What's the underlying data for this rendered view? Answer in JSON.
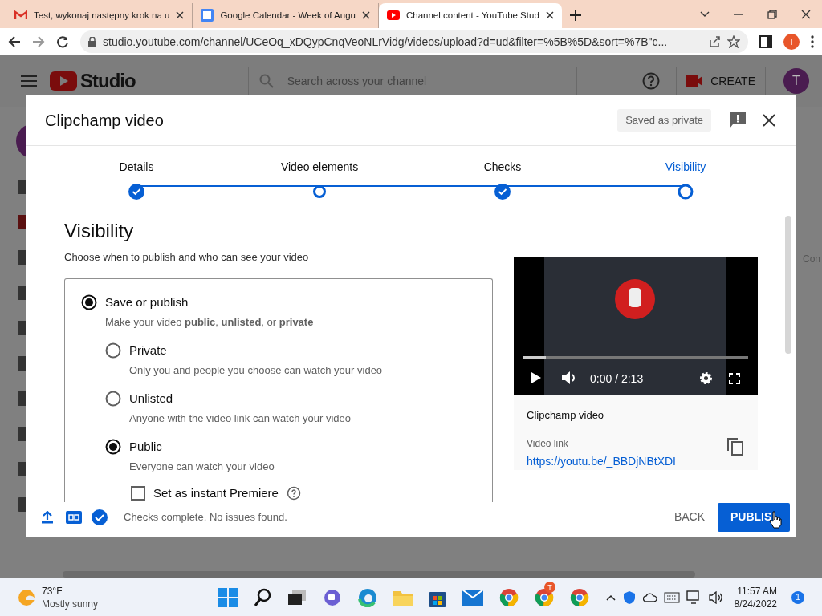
{
  "browser": {
    "tabs": [
      {
        "title": "Test, wykonaj następny krok na u",
        "kind": "mail",
        "selected": false
      },
      {
        "title": "Google Calendar - Week of Augu",
        "kind": "calendar",
        "selected": false
      },
      {
        "title": "Channel content - YouTube Stud",
        "kind": "youtube",
        "selected": true
      }
    ],
    "url": "studio.youtube.com/channel/UCeOq_xDQypCnqVeoNLrVidg/videos/upload?d=ud&filter=%5B%5D&sort=%7B\"c...",
    "profile_initial": "T"
  },
  "studio": {
    "logo_text": "Studio",
    "search": {
      "placeholder": "Search across your channel"
    },
    "create_label": "CREATE",
    "avatar_initial": "T",
    "edge_text": "Con"
  },
  "dialog": {
    "title": "Clipchamp video",
    "save_status": "Saved as private",
    "steps": [
      {
        "label": "Details",
        "done": true,
        "selected": false
      },
      {
        "label": "Video elements",
        "done": false,
        "selected": false
      },
      {
        "label": "Checks",
        "done": true,
        "selected": false
      },
      {
        "label": "Visibility",
        "done": false,
        "selected": true
      }
    ],
    "heading": "Visibility",
    "subheading": "Choose when to publish and who can see your video",
    "save_or_publish": {
      "label": "Save or publish",
      "selected": true,
      "description": "Make your video **public**, **unlisted**, or **private**",
      "options": [
        {
          "label": "Private",
          "description": "Only you and people you choose can watch your video",
          "selected": false
        },
        {
          "label": "Unlisted",
          "description": "Anyone with the video link can watch your video",
          "selected": false
        },
        {
          "label": "Public",
          "description": "Everyone can watch your video",
          "selected": true
        }
      ],
      "premiere": {
        "label": "Set as instant Premiere",
        "checked": false
      }
    },
    "preview": {
      "time": "0:00 / 2:13",
      "level": 0.1,
      "title": "Clipchamp video",
      "link_label": "Video link",
      "link": "https://youtu.be/_BBDjNBtXDI"
    },
    "footer": {
      "status": "Checks complete. No issues found.",
      "back": "BACK",
      "publish": "PUBLIS"
    }
  },
  "taskbar": {
    "temperature": "73°F",
    "condition": "Mostly sunny",
    "chrome_badge": "T",
    "time": "11:57 AM",
    "date": "8/24/2022",
    "notification_count": "1"
  }
}
